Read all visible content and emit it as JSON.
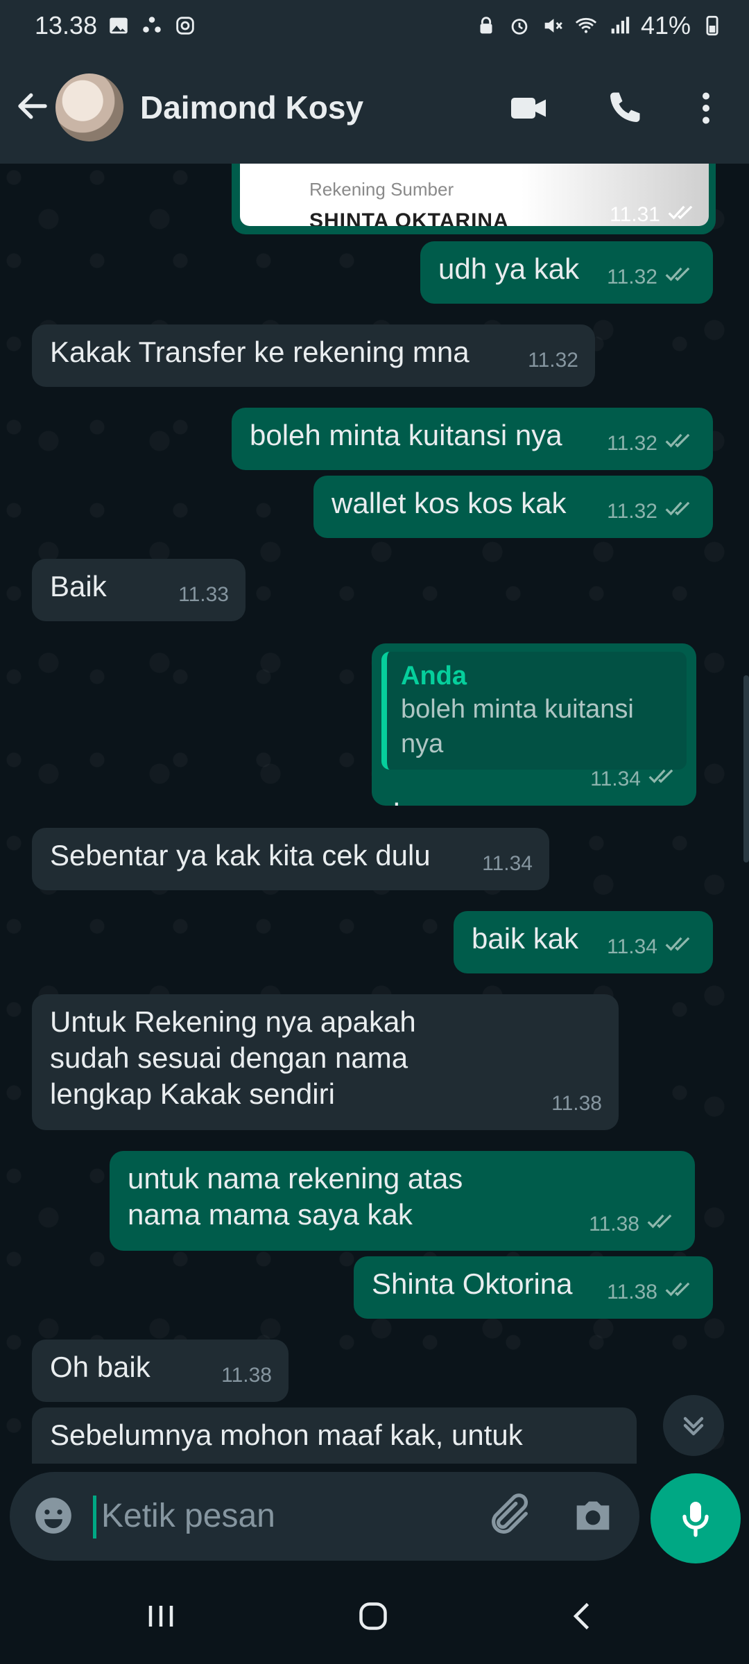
{
  "status_bar": {
    "time": "13.38",
    "battery": "41%"
  },
  "header": {
    "contact_name": "Daimond Kosy"
  },
  "top_card": {
    "label": "Rekening Sumber",
    "name": "SHINTA OKTARINA",
    "time": "11.31"
  },
  "messages": [
    {
      "dir": "out",
      "text": "udh ya kak",
      "time": "11.32",
      "read": true
    },
    {
      "dir": "in",
      "text": "Kakak Transfer ke rekening mna",
      "time": "11.32"
    },
    {
      "dir": "out",
      "text": "boleh minta kuitansi nya",
      "time": "11.32",
      "read": true
    },
    {
      "dir": "out",
      "text": "wallet kos kos kak",
      "time": "11.32",
      "read": true
    },
    {
      "dir": "in",
      "text": "Baik",
      "time": "11.33"
    },
    {
      "dir": "out",
      "text": ".",
      "time": "11.34",
      "read": true,
      "quote": {
        "author": "Anda",
        "text": "boleh minta kuitansi nya"
      }
    },
    {
      "dir": "in",
      "text": "Sebentar ya kak kita cek dulu",
      "time": "11.34"
    },
    {
      "dir": "out",
      "text": "baik kak",
      "time": "11.34",
      "read": true
    },
    {
      "dir": "in",
      "text": "Untuk Rekening nya apakah sudah sesuai dengan nama lengkap Kakak sendiri",
      "time": "11.38"
    },
    {
      "dir": "out",
      "text": "untuk nama rekening atas nama mama saya kak",
      "time": "11.38",
      "read": true
    },
    {
      "dir": "out",
      "text": "Shinta Oktorina",
      "time": "11.38",
      "read": true
    },
    {
      "dir": "in",
      "text": "Oh baik",
      "time": "11.38"
    },
    {
      "dir": "in",
      "text": "Sebelumnya mohon maaf kak, untuk",
      "time": ""
    }
  ],
  "composer": {
    "placeholder": "Ketik pesan"
  },
  "colors": {
    "incoming": "#202c33",
    "outgoing": "#005c4b",
    "accent": "#00a884",
    "ticks": "#8fb8ad"
  },
  "icons": {
    "back": "arrow-left",
    "video": "video-camera",
    "call": "phone",
    "menu": "more-vertical",
    "emoji": "smiley",
    "attach": "paperclip",
    "camera": "camera",
    "mic": "microphone"
  }
}
